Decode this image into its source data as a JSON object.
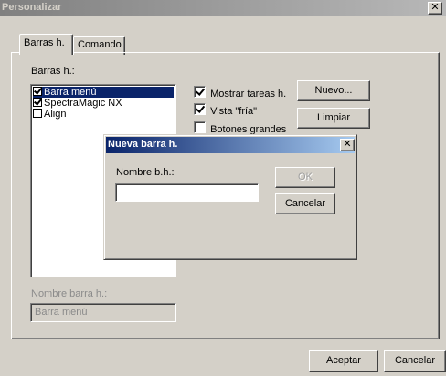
{
  "window": {
    "title": "Personalizar",
    "close_glyph": "✕"
  },
  "tabs": [
    {
      "label": "Barras h."
    },
    {
      "label": "Comando"
    }
  ],
  "panel": {
    "list_label": "Barras h.:",
    "list_items": [
      {
        "label": "Barra menú",
        "checked": true,
        "selected": true
      },
      {
        "label": "SpectraMagic NX",
        "checked": true,
        "selected": false
      },
      {
        "label": "Align",
        "checked": false,
        "selected": false
      }
    ],
    "options": [
      {
        "label": "Mostrar tareas h.",
        "checked": true
      },
      {
        "label": "Vista \"fría\"",
        "checked": true
      },
      {
        "label": "Botones grandes",
        "checked": false
      }
    ],
    "new_button": "Nuevo...",
    "clear_button": "Limpiar",
    "name_label": "Nombre barra h.:",
    "name_value": "Barra menú"
  },
  "footer": {
    "accept_button": "Aceptar",
    "cancel_button": "Cancelar"
  },
  "modal": {
    "title": "Nueva barra h.",
    "close_glyph": "✕",
    "name_label": "Nombre b.h.:",
    "name_value": "",
    "ok_button": "OK",
    "cancel_button": "Cancelar"
  },
  "colors": {
    "active_title": "#0a246a",
    "inactive_title": "#808080",
    "selection": "#0a246a",
    "face": "#d4d0c8"
  }
}
